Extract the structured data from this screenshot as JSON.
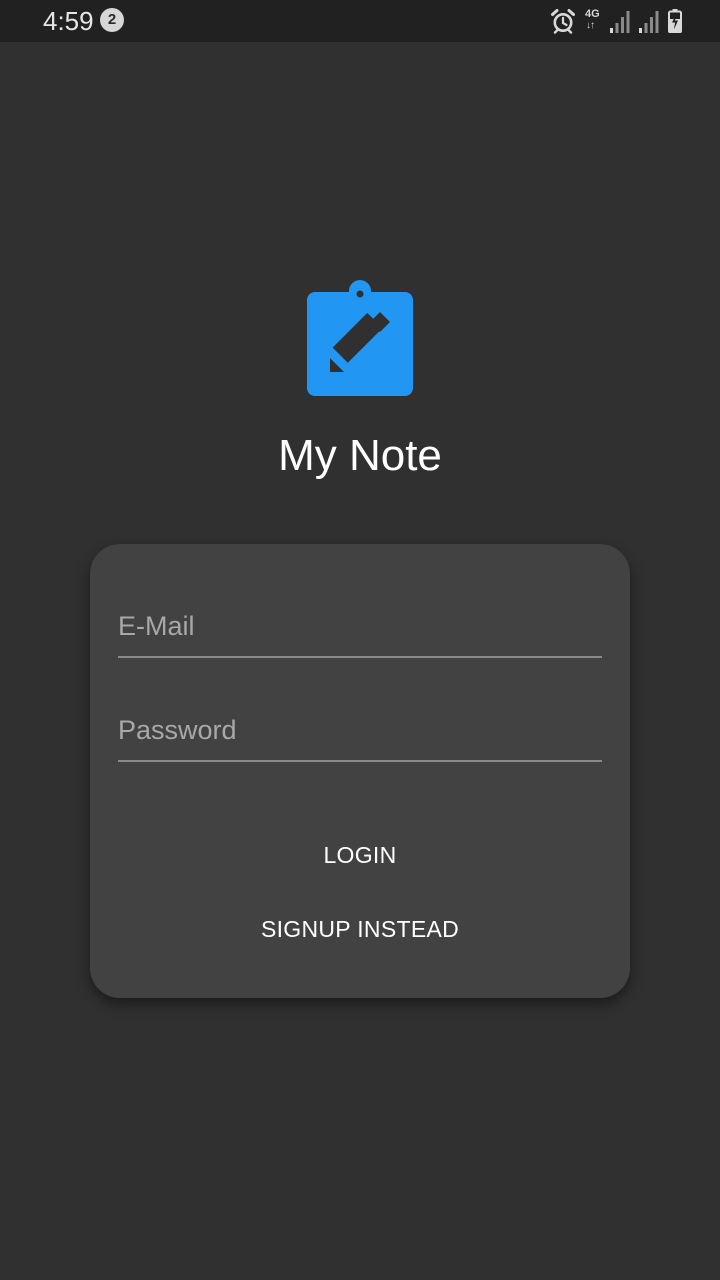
{
  "status_bar": {
    "time": "4:59",
    "notification_count": "2",
    "network_type": "4G",
    "icons": [
      "alarm-icon",
      "network-4g-icon",
      "signal-icon",
      "signal-icon",
      "battery-charging-icon"
    ]
  },
  "app": {
    "title": "My Note",
    "logo_icon": "clipboard-edit-icon",
    "accent_color": "#2196f3",
    "background_color": "#303030",
    "card_color": "#424242"
  },
  "login_form": {
    "email_placeholder": "E-Mail",
    "email_value": "",
    "password_placeholder": "Password",
    "password_value": "",
    "login_label": "LOGIN",
    "signup_label": "SIGNUP INSTEAD"
  }
}
